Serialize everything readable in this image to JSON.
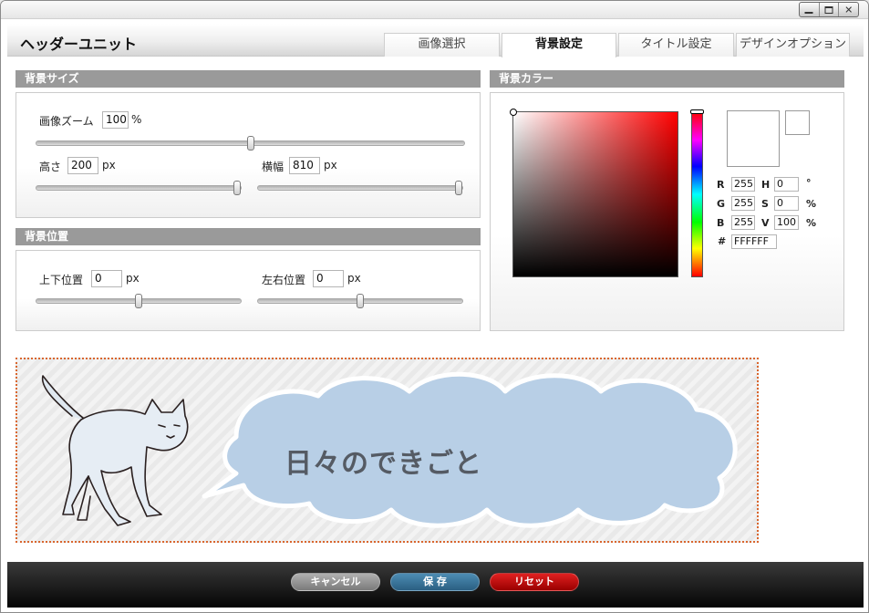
{
  "window": {
    "controls": [
      "minimize",
      "maximize",
      "close"
    ]
  },
  "header": {
    "title": "ヘッダーユニット",
    "tabs": [
      {
        "label": "画像選択",
        "active": false
      },
      {
        "label": "背景設定",
        "active": true
      },
      {
        "label": "タイトル設定",
        "active": false
      },
      {
        "label": "デザインオプション",
        "active": false
      }
    ]
  },
  "bg_size": {
    "heading": "背景サイズ",
    "zoom_label": "画像ズーム",
    "zoom_value": "100",
    "zoom_unit": "%",
    "height_label": "高さ",
    "height_value": "200",
    "height_unit": "px",
    "width_label": "横幅",
    "width_value": "810",
    "width_unit": "px"
  },
  "bg_position": {
    "heading": "背景位置",
    "vertical_label": "上下位置",
    "vertical_value": "0",
    "vertical_unit": "px",
    "horizontal_label": "左右位置",
    "horizontal_value": "0",
    "horizontal_unit": "px"
  },
  "bg_color": {
    "heading": "背景カラー",
    "r_label": "R",
    "r_value": "255",
    "g_label": "G",
    "g_value": "255",
    "b_label": "B",
    "b_value": "255",
    "h_label": "H",
    "h_value": "0",
    "h_unit": "°",
    "s_label": "S",
    "s_value": "0",
    "s_unit": "%",
    "v_label": "V",
    "v_value": "100",
    "v_unit": "%",
    "hex_label": "#",
    "hex_value": "FFFFFF",
    "current_color": "#ffffff"
  },
  "preview": {
    "title_text": "日々のできごと",
    "cloud_color": "#b8cfe6",
    "icons": [
      "cat-illustration",
      "speech-cloud"
    ]
  },
  "footer": {
    "cancel_label": "キャンセル",
    "save_label": "保 存",
    "reset_label": "リセット"
  }
}
